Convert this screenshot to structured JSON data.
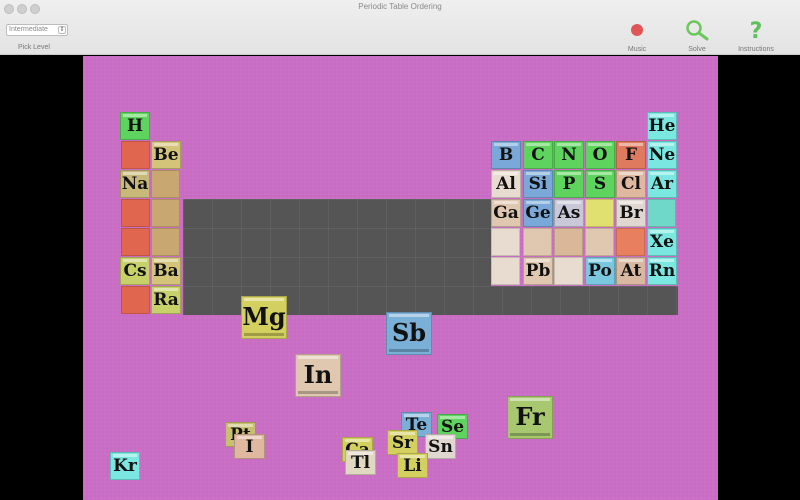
{
  "window": {
    "title": "Periodic Table Ordering"
  },
  "toolbar": {
    "level_value": "Intermediate",
    "level_label": "Pick Level",
    "music_label": "Music",
    "solve_label": "Solve",
    "instructions_label": "Instructions"
  },
  "colors": {
    "board": "#c86cc4",
    "empty_grid": "#555555",
    "music": "#e05555",
    "solve": "#6cc85c",
    "instructions": "#5cc05c"
  },
  "placed": [
    {
      "symbol": "H",
      "color": "#5ed45e"
    },
    {
      "symbol": "He",
      "color": "#7ae8e0"
    },
    {
      "symbol": "Be",
      "color": "#d4c47a"
    },
    {
      "symbol": "B",
      "color": "#7aa8d8"
    },
    {
      "symbol": "C",
      "color": "#5ed45e"
    },
    {
      "symbol": "N",
      "color": "#5ed45e"
    },
    {
      "symbol": "O",
      "color": "#5ed45e"
    },
    {
      "symbol": "F",
      "color": "#e07a5e"
    },
    {
      "symbol": "Ne",
      "color": "#7ae8e0"
    },
    {
      "symbol": "Na",
      "color": "#c8b87a"
    },
    {
      "symbol": "Al",
      "color": "#e8dcd0"
    },
    {
      "symbol": "Si",
      "color": "#7aa8d8"
    },
    {
      "symbol": "P",
      "color": "#5ed45e"
    },
    {
      "symbol": "S",
      "color": "#5ed45e"
    },
    {
      "symbol": "Cl",
      "color": "#e0b8a0"
    },
    {
      "symbol": "Ar",
      "color": "#7ae8e0"
    },
    {
      "symbol": "Ga",
      "color": "#e0c8b0"
    },
    {
      "symbol": "Ge",
      "color": "#7aa8d8"
    },
    {
      "symbol": "As",
      "color": "#c8c8d8"
    },
    {
      "symbol": "Br",
      "color": "#e0d8d0"
    },
    {
      "symbol": "Xe",
      "color": "#7ae8e0"
    },
    {
      "symbol": "Cs",
      "color": "#c8d06a"
    },
    {
      "symbol": "Ba",
      "color": "#d4c47a"
    },
    {
      "symbol": "Pb",
      "color": "#e0c8b0"
    },
    {
      "symbol": "Po",
      "color": "#7ac8e0"
    },
    {
      "symbol": "At",
      "color": "#d8b8a0"
    },
    {
      "symbol": "Rn",
      "color": "#7ae8e0"
    },
    {
      "symbol": "Ra",
      "color": "#c8d06a"
    }
  ],
  "loose": [
    {
      "symbol": "Mg",
      "color": "#d4d060"
    },
    {
      "symbol": "Sb",
      "color": "#7ab0d8"
    },
    {
      "symbol": "In",
      "color": "#e0c8b0"
    },
    {
      "symbol": "Fr",
      "color": "#a8c870"
    },
    {
      "symbol": "Kr",
      "color": "#7ae8e0"
    },
    {
      "symbol": "Pt",
      "color": "#c8c070"
    },
    {
      "symbol": "I",
      "color": "#e0b8a0"
    },
    {
      "symbol": "Te",
      "color": "#7ab0d8"
    },
    {
      "symbol": "Se",
      "color": "#5ed45e"
    },
    {
      "symbol": "Sr",
      "color": "#d4d060"
    },
    {
      "symbol": "Sn",
      "color": "#e0d8d0"
    },
    {
      "symbol": "Tl",
      "color": "#e0d8c0"
    },
    {
      "symbol": "Li",
      "color": "#d4d060"
    },
    {
      "symbol": "Ca",
      "color": "#d4d060"
    }
  ]
}
